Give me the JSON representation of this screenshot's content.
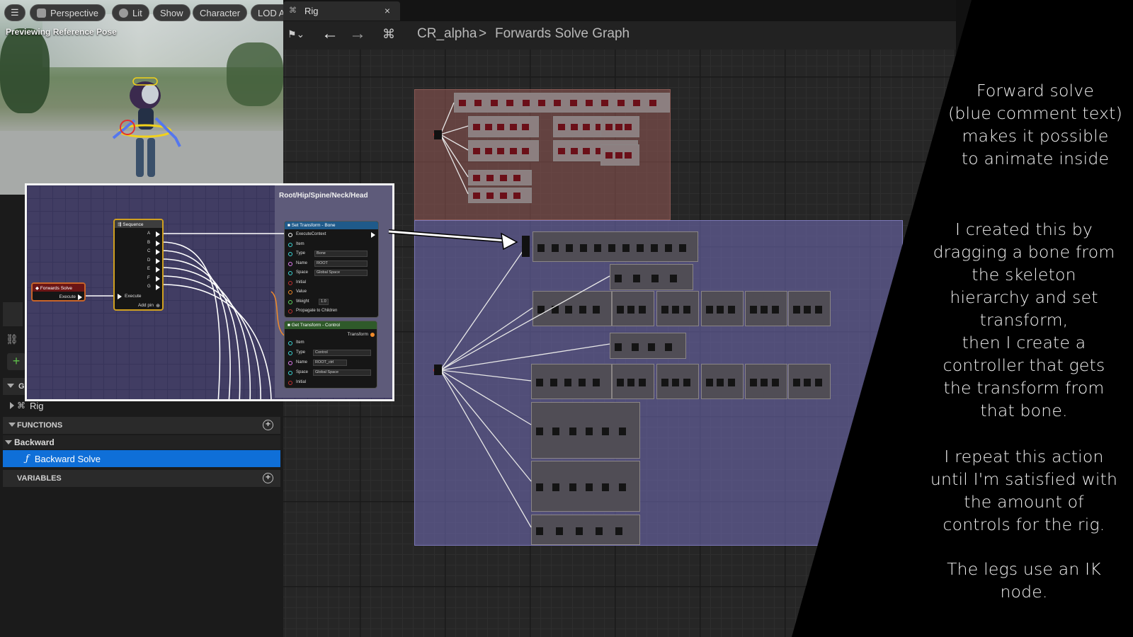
{
  "viewport": {
    "toolbar": [
      "Perspective",
      "Lit",
      "Show",
      "Character",
      "LOD A"
    ],
    "preview_label": "Previewing Reference Pose"
  },
  "tab": {
    "label": "Rig",
    "close": "×"
  },
  "breadcrumb": {
    "root": "CR_alpha",
    "separator": ">",
    "current": "Forwards Solve Graph"
  },
  "inset": {
    "comment_title": "Root/Hip/Spine/Neck/Head",
    "forwards_solve": {
      "title": "Forwards Solve",
      "pin": "Execute"
    },
    "sequence": {
      "title": "Sequence",
      "pins": [
        "A",
        "B",
        "C",
        "D",
        "E",
        "F",
        "G"
      ],
      "input": "Execute",
      "add_pin": "Add pin"
    },
    "set_transform": {
      "title": "Set Transform - Bone",
      "rows": [
        "ExecuteContext",
        "Item",
        "Type",
        "Name",
        "Space",
        "Initial",
        "Value",
        "Weight",
        "Propagate to Children"
      ],
      "type_val": "Bone",
      "name_val": "ROOT",
      "space_val": "Global Space",
      "weight_val": "1.0"
    },
    "get_transform": {
      "title": "Get Transform - Control",
      "output": "Transform",
      "rows": [
        "Item",
        "Type",
        "Name",
        "Space",
        "Initial"
      ],
      "type_val": "Control",
      "name_val": "ROOT_ctrl",
      "space_val": "Global Space"
    }
  },
  "panel": {
    "graphs_label": "GI",
    "rig_item": "Rig",
    "functions": "FUNCTIONS",
    "backward": "Backward",
    "backward_solve": "Backward Solve",
    "variables": "VARIABLES"
  },
  "annotation": {
    "p1": [
      "Forward solve",
      "(blue comment text)",
      "makes it possible",
      "to animate inside"
    ],
    "p2": [
      "I created this by",
      "dragging a bone from",
      "the skeleton",
      "hierarchy and set",
      "transform,",
      "then I create a",
      "controller that gets",
      "the transform from",
      "that bone."
    ],
    "p3": [
      "I repeat this action",
      "until I'm satisfied with",
      "the amount of",
      "controls for the rig."
    ],
    "p4": [
      "The legs use an IK",
      "node."
    ]
  },
  "colors": {
    "selection": "#0f6fd8",
    "comment_red": "#965a55",
    "comment_blue": "#6e69af",
    "exec_white": "#ffffff"
  }
}
